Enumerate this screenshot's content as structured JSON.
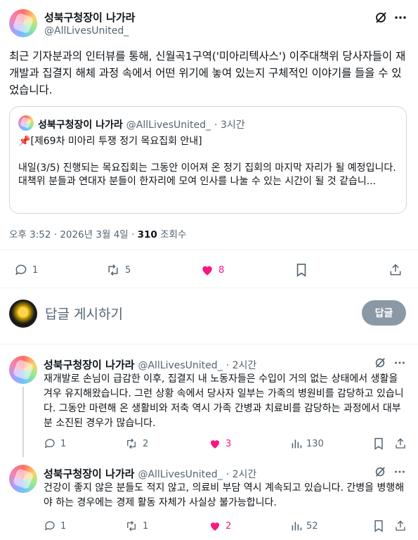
{
  "author": {
    "name": "성북구청장이 나가라",
    "handle": "@AllLivesUnited_"
  },
  "post": {
    "text": "최근 기자분과의 인터뷰를 통해, 신월곡1구역('미아리텍사스') 이주대책위 당사자들이 재개발과 집결지 해체 과정 속에서 어떤 위기에 놓여 있는지 구체적인 이야기를 들을 수 있었습니다.",
    "quote": {
      "name": "성북구청장이 나가라",
      "handle": "@AllLivesUnited_",
      "time": "· 3시간",
      "pin": "📌",
      "title": "[제69차 미아리 투쟁 정기 목요집회 안내]",
      "line1": "내일(3/5) 진행되는 목요집회는 그동안 이어져 온 정기 집회의 마지막 자리가 될 예정입니다.",
      "line2": "대책위 분들과 연대자 분들이 한자리에 모여 인사를 나눌 수 있는 시간이 될 것 같습니..."
    },
    "timestamp": "오후 3:52 · 2026년 3월 4일 · ",
    "views_count": "310",
    "views_label": " 조회수",
    "stats": {
      "replies": "1",
      "reposts": "5",
      "likes": "8"
    }
  },
  "composer": {
    "placeholder": "답글 게시하기",
    "button": "답글"
  },
  "replies": [
    {
      "name": "성북구청장이 나가라",
      "handle": "@AllLivesUnited_",
      "time": "· 2시간",
      "text": "재개발로 손님이 급감한 이후, 집결지 내 노동자들은 수입이 거의 없는 상태에서 생활을 겨우 유지해왔습니다. 그런 상황 속에서 당사자 일부는 가족의 병원비를 감당하고 있습니다. 그동안 마련해 온 생활비와 저축 역시 가족 간병과 치료비를 감당하는 과정에서 대부분 소진된 경우가 많습니다.",
      "stats": {
        "replies": "1",
        "reposts": "2",
        "likes": "3",
        "views": "130"
      }
    },
    {
      "name": "성북구청장이 나가라",
      "handle": "@AllLivesUnited_",
      "time": "· 2시간",
      "text": "건강이 좋지 않은 분들도 적지 않고, 의료비 부담 역시 계속되고 있습니다. 간병을 병행해야 하는 경우에는 경제 활동 자체가 사실상 불가능합니다.",
      "stats": {
        "replies": "1",
        "reposts": "1",
        "likes": "2",
        "views": "52"
      }
    }
  ],
  "colors": {
    "like": "#f91880",
    "muted": "#536471",
    "text": "#0f1419"
  }
}
